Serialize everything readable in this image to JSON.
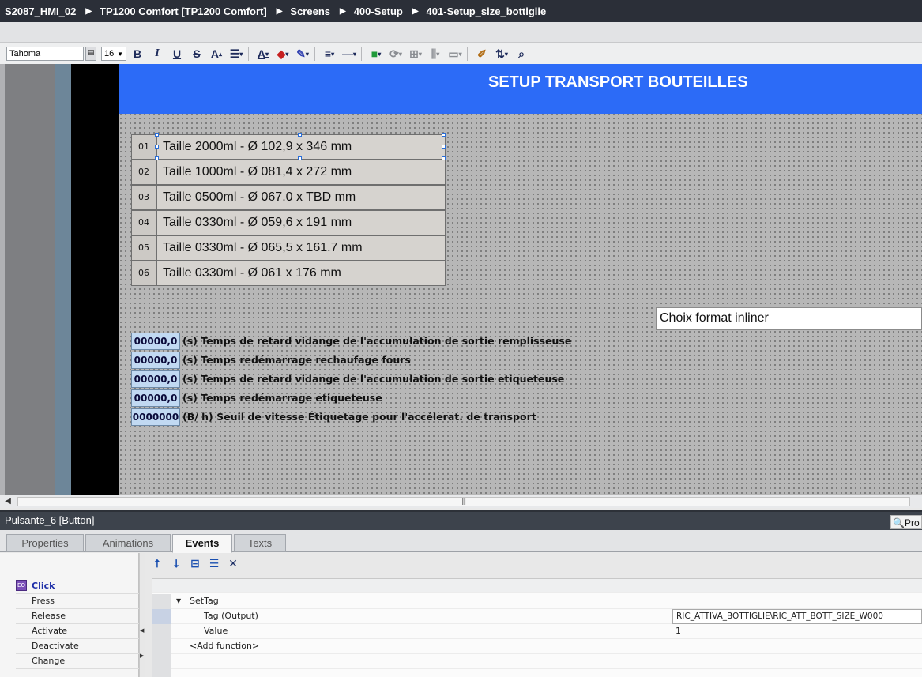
{
  "breadcrumb": [
    "S2087_HMI_02",
    "TP1200 Comfort [TP1200 Comfort]",
    "Screens",
    "400-Setup",
    "401-Setup_size_bottiglie"
  ],
  "toolbar": {
    "font_name": "Tahoma",
    "font_size": "16",
    "bold": "B",
    "italic": "I",
    "underline": "U",
    "strike": "S",
    "font_grow": "A",
    "font_color": "A"
  },
  "screen": {
    "title": "SETUP TRANSPORT BOUTEILLES",
    "size_buttons": [
      {
        "num": "01",
        "label": "Taille 2000ml - Ø 102,9 x 346 mm"
      },
      {
        "num": "02",
        "label": "Taille 1000ml - Ø 081,4 x 272 mm"
      },
      {
        "num": "03",
        "label": "Taille 0500ml - Ø 067.0 x TBD mm"
      },
      {
        "num": "04",
        "label": "Taille 0330ml - Ø 059,6 x 191 mm"
      },
      {
        "num": "05",
        "label": "Taille 0330ml - Ø 065,5 x 161.7 mm"
      },
      {
        "num": "06",
        "label": "Taille 0330ml - Ø 061 x 176 mm"
      }
    ],
    "choice_field": "Choix format inliner",
    "params": [
      {
        "value": "00000,0",
        "label": "(s) Temps de retard vidange de l'accumulation de sortie remplisseuse"
      },
      {
        "value": "00000,0",
        "label": "(s) Temps redémarrage rechaufage fours"
      },
      {
        "value": "00000,0",
        "label": "(s) Temps de retard vidange de l'accumulation de sortie  etiqueteuse"
      },
      {
        "value": "00000,0",
        "label": "(s) Temps redémarrage etiqueteuse"
      },
      {
        "value": "0000000",
        "label": "(B/ h) Seuil de vitesse Étiquetage pour l'accélerat. de transport"
      }
    ]
  },
  "properties": {
    "title": "Pulsante_6 [Button]",
    "right_button": "Pro",
    "tabs": [
      "Properties",
      "Animations",
      "Events",
      "Texts"
    ],
    "active_tab": "Events",
    "events": [
      "Click",
      "Press",
      "Release",
      "Activate",
      "Deactivate",
      "Change"
    ],
    "selected_event": "Click",
    "click_icon_text": "EO",
    "function_name": "SetTag",
    "rows": [
      {
        "label": "Tag (Output)",
        "value": "RIC_ATTIVA_BOTTIGLIE\\RIC_ATT_BOTT_SIZE_W000"
      },
      {
        "label": "Value",
        "value": "1"
      }
    ],
    "add_function": "<Add function>"
  },
  "colors": {
    "header_blue": "#2c6bf7",
    "param_field": "#c1d9f2",
    "title_bar": "#2b2f38"
  }
}
